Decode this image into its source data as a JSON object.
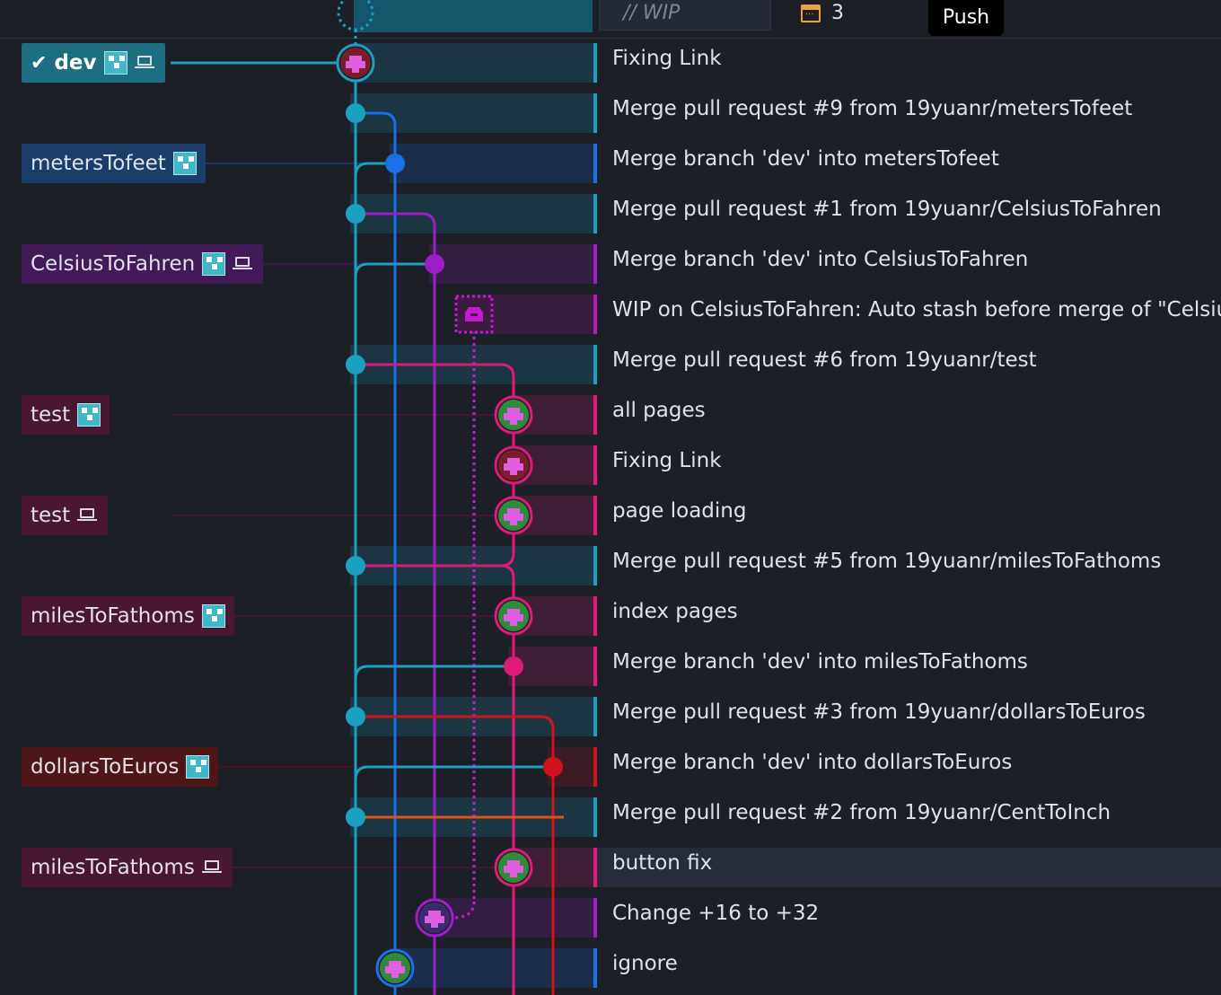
{
  "toolbar": {
    "wip_label": "// WIP",
    "stash_count": "3",
    "push_tooltip": "Push"
  },
  "branch_labels": [
    {
      "name": "dev",
      "row": 0,
      "current": true,
      "remote": true,
      "local": true,
      "color": "#1c6e80"
    },
    {
      "name": "metersTofeet",
      "row": 2,
      "remote": true,
      "local": false,
      "color": "#1b3d6a"
    },
    {
      "name": "CelsiusToFahren",
      "row": 4,
      "remote": true,
      "local": true,
      "color": "#421a57"
    },
    {
      "name": "test",
      "row": 7,
      "remote": true,
      "local": false,
      "color": "#4a1733"
    },
    {
      "name": "test",
      "row": 9,
      "remote": false,
      "local": true,
      "color": "#4a1733"
    },
    {
      "name": "milesToFathoms",
      "row": 11,
      "remote": true,
      "local": false,
      "color": "#4a1733"
    },
    {
      "name": "dollarsToEuros",
      "row": 14,
      "remote": true,
      "local": false,
      "color": "#4e1617"
    },
    {
      "name": "milesToFathoms",
      "row": 16,
      "remote": false,
      "local": true,
      "color": "#4a1733"
    }
  ],
  "commits": [
    {
      "message": "Fixing Link",
      "lane": "cyan",
      "color": "#1ba1c0"
    },
    {
      "message": "Merge pull request #9 from 19yuanr/metersTofeet",
      "lane": "cyan",
      "color": "#1ba1c0"
    },
    {
      "message": "Merge branch 'dev' into metersTofeet",
      "lane": "blue",
      "color": "#1c6fe6"
    },
    {
      "message": "Merge pull request #1 from 19yuanr/CelsiusToFahren",
      "lane": "cyan",
      "color": "#1ba1c0"
    },
    {
      "message": "Merge branch 'dev' into CelsiusToFahren",
      "lane": "purple",
      "color": "#9b1ec9"
    },
    {
      "message": "WIP on CelsiusToFahren: Auto stash before merge of \"Celsius",
      "lane": "magenta",
      "color": "#b71bb3"
    },
    {
      "message": "Merge pull request #6 from 19yuanr/test",
      "lane": "cyan",
      "color": "#1ba1c0"
    },
    {
      "message": "all pages",
      "lane": "pink",
      "color": "#e01a78"
    },
    {
      "message": "Fixing Link",
      "lane": "pink",
      "color": "#e01a78"
    },
    {
      "message": "page loading",
      "lane": "pink",
      "color": "#e01a78"
    },
    {
      "message": "Merge pull request #5 from 19yuanr/milesToFathoms",
      "lane": "cyan",
      "color": "#1ba1c0"
    },
    {
      "message": "index pages",
      "lane": "pink",
      "color": "#e01a78"
    },
    {
      "message": "Merge branch 'dev' into milesToFathoms",
      "lane": "pink",
      "color": "#e01a78"
    },
    {
      "message": "Merge pull request #3 from 19yuanr/dollarsToEuros",
      "lane": "cyan",
      "color": "#1ba1c0"
    },
    {
      "message": "Merge branch 'dev' into dollarsToEuros",
      "lane": "red",
      "color": "#d0121b"
    },
    {
      "message": "Merge pull request #2 from 19yuanr/CentToInch",
      "lane": "cyan",
      "color": "#1ba1c0"
    },
    {
      "message": "button fix",
      "lane": "pink",
      "color": "#e01a78",
      "selected": true
    },
    {
      "message": "Change +16 to +32",
      "lane": "purple",
      "color": "#9b1ec9"
    },
    {
      "message": "ignore",
      "lane": "blue",
      "color": "#1c6fe6"
    }
  ],
  "icons": {
    "remote": "github-avatar-icon",
    "local": "laptop-icon",
    "current": "checkmark-icon",
    "stash": "stash-icon",
    "count": "stash-count-icon"
  }
}
